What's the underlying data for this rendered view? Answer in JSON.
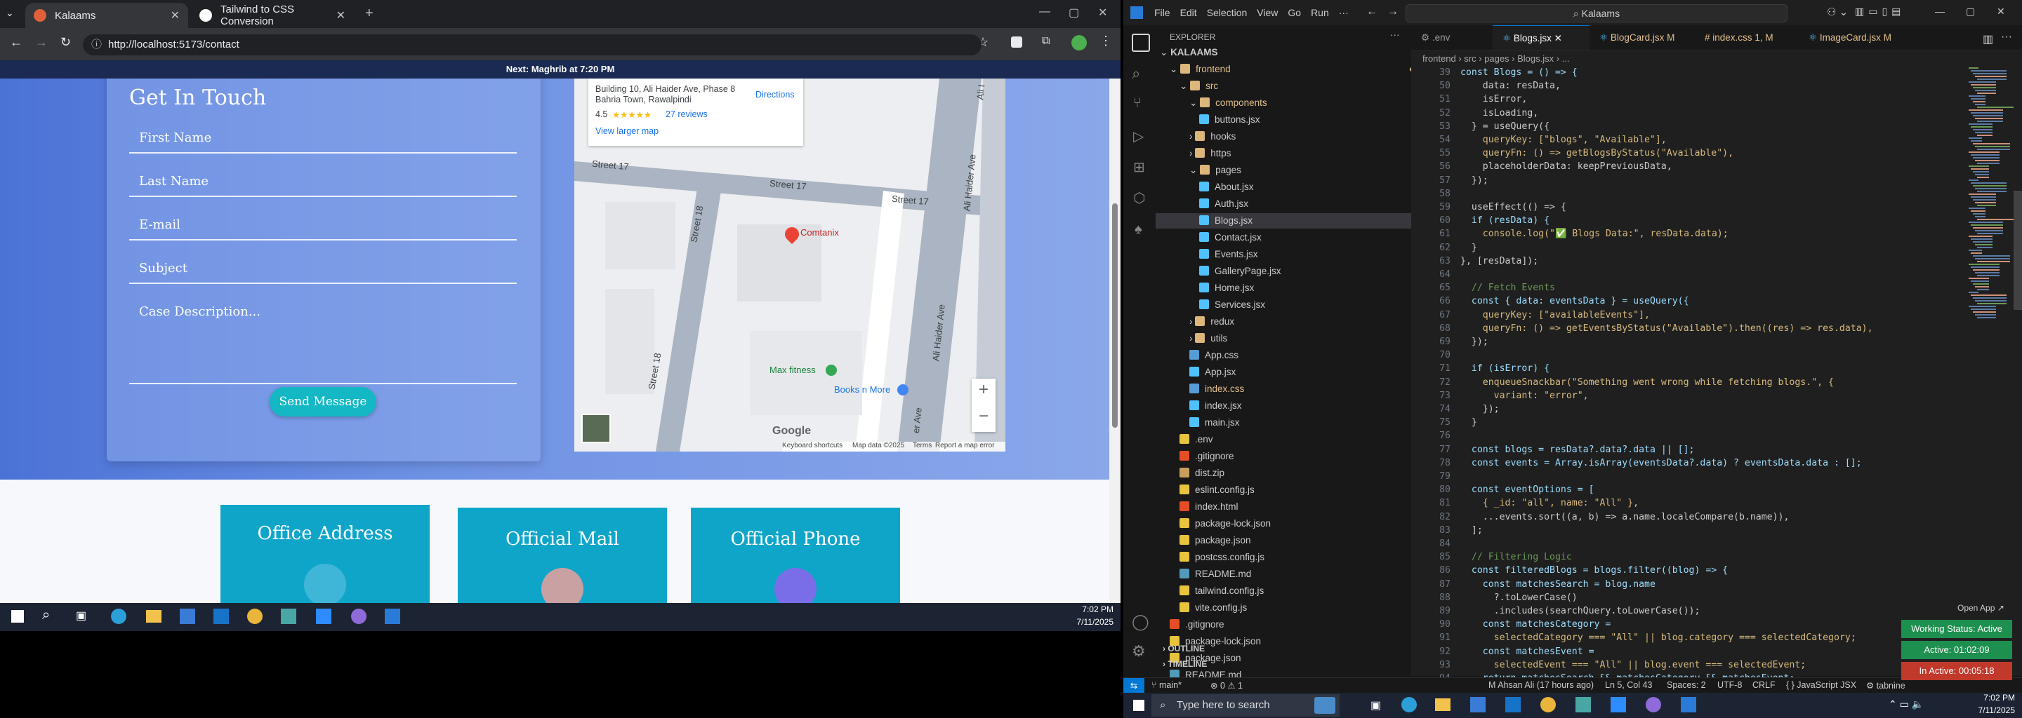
{
  "browser": {
    "tabs": [
      {
        "label": "Kalaams",
        "active": true
      },
      {
        "label": "Tailwind to CSS Conversion",
        "active": false
      }
    ],
    "url": "http://localhost:5173/contact",
    "notice": "Next: Maghrib at 7:20 PM",
    "form": {
      "title": "Get In Touch",
      "first_name": "First Name",
      "last_name": "Last Name",
      "email": "E-mail",
      "subject": "Subject",
      "description": "Case Description...",
      "send": "Send Message"
    },
    "map": {
      "address": "Building 10, Ali Haider Ave, Phase 8 Bahria Town, Rawalpindi",
      "directions": "Directions",
      "rating": "4.5",
      "stars": "★★★★★",
      "reviews": "27 reviews",
      "view_larger": "View larger map",
      "place": "Comtanix",
      "poi1": "Max fitness",
      "poi2": "Books n More",
      "street_a": "Street 17",
      "street_b": "Street 17",
      "street_c": "Street 17",
      "street_d": "Street 18",
      "street_e": "Street 18",
      "ave1": "Ali Haider Ave",
      "ave2": "Ali Haider Ave",
      "ave3": "er Ave",
      "ave4": "Ali I",
      "zoom_in": "+",
      "zoom_out": "−",
      "logo": "Google",
      "footer": [
        "Keyboard shortcuts",
        "Map data ©2025",
        "Terms",
        "Report a map error"
      ]
    },
    "cards": [
      "Office Address",
      "Official Mail",
      "Official Phone"
    ]
  },
  "left_taskbar": {
    "time": "7:02 PM",
    "date": "7/11/2025"
  },
  "vscode": {
    "menu": [
      "File",
      "Edit",
      "Selection",
      "View",
      "Go",
      "Run",
      "···"
    ],
    "search": "Kalaams",
    "explorer_title": "EXPLORER",
    "tree": [
      {
        "label": "KALAAMS",
        "indent": 0,
        "kind": "root"
      },
      {
        "label": "frontend",
        "indent": 1,
        "kind": "folder-open",
        "color": "#e2c08d"
      },
      {
        "label": "src",
        "indent": 2,
        "kind": "folder-open",
        "color": "#e2c08d"
      },
      {
        "label": "components",
        "indent": 3,
        "kind": "folder-open",
        "color": "#e2c08d"
      },
      {
        "label": "buttons.jsx",
        "indent": 4,
        "kind": "jsx"
      },
      {
        "label": "hooks",
        "indent": 3,
        "kind": "folder"
      },
      {
        "label": "https",
        "indent": 3,
        "kind": "folder"
      },
      {
        "label": "pages",
        "indent": 3,
        "kind": "folder-open"
      },
      {
        "label": "About.jsx",
        "indent": 4,
        "kind": "jsx"
      },
      {
        "label": "Auth.jsx",
        "indent": 4,
        "kind": "jsx"
      },
      {
        "label": "Blogs.jsx",
        "indent": 4,
        "kind": "jsx",
        "selected": true
      },
      {
        "label": "Contact.jsx",
        "indent": 4,
        "kind": "jsx"
      },
      {
        "label": "Events.jsx",
        "indent": 4,
        "kind": "jsx"
      },
      {
        "label": "GalleryPage.jsx",
        "indent": 4,
        "kind": "jsx"
      },
      {
        "label": "Home.jsx",
        "indent": 4,
        "kind": "jsx"
      },
      {
        "label": "Services.jsx",
        "indent": 4,
        "kind": "jsx"
      },
      {
        "label": "redux",
        "indent": 3,
        "kind": "folder"
      },
      {
        "label": "utils",
        "indent": 3,
        "kind": "folder"
      },
      {
        "label": "App.css",
        "indent": 3,
        "kind": "css"
      },
      {
        "label": "App.jsx",
        "indent": 3,
        "kind": "jsx"
      },
      {
        "label": "index.css",
        "indent": 3,
        "kind": "css",
        "badge": "1, M",
        "color": "#e2c08d"
      },
      {
        "label": "index.jsx",
        "indent": 3,
        "kind": "jsx"
      },
      {
        "label": "main.jsx",
        "indent": 3,
        "kind": "jsx"
      },
      {
        "label": ".env",
        "indent": 2,
        "kind": "env"
      },
      {
        "label": ".gitignore",
        "indent": 2,
        "kind": "git"
      },
      {
        "label": "dist.zip",
        "indent": 2,
        "kind": "zip"
      },
      {
        "label": "eslint.config.js",
        "indent": 2,
        "kind": "js"
      },
      {
        "label": "index.html",
        "indent": 2,
        "kind": "html"
      },
      {
        "label": "package-lock.json",
        "indent": 2,
        "kind": "json"
      },
      {
        "label": "package.json",
        "indent": 2,
        "kind": "json"
      },
      {
        "label": "postcss.config.js",
        "indent": 2,
        "kind": "js"
      },
      {
        "label": "README.md",
        "indent": 2,
        "kind": "md"
      },
      {
        "label": "tailwind.config.js",
        "indent": 2,
        "kind": "js"
      },
      {
        "label": "vite.config.js",
        "indent": 2,
        "kind": "js"
      },
      {
        "label": ".gitignore",
        "indent": 1,
        "kind": "git"
      },
      {
        "label": "package-lock.json",
        "indent": 1,
        "kind": "json"
      },
      {
        "label": "package.json",
        "indent": 1,
        "kind": "json"
      },
      {
        "label": "README.md",
        "indent": 1,
        "kind": "md"
      }
    ],
    "outline": "OUTLINE",
    "timeline": "TIMELINE",
    "tabs": [
      {
        "label": ".env",
        "active": false
      },
      {
        "label": "Blogs.jsx",
        "active": true
      },
      {
        "label": "BlogCard.jsx",
        "suffix": "M",
        "active": false
      },
      {
        "label": "index.css",
        "suffix": "1, M",
        "active": false
      },
      {
        "label": "ImageCard.jsx",
        "suffix": "M",
        "active": false
      }
    ],
    "breadcrumb": "frontend › src › pages › Blogs.jsx › ...",
    "code_lines": [
      {
        "n": "39",
        "t": "const Blogs = () => {"
      },
      {
        "n": "50",
        "t": "    data: resData,"
      },
      {
        "n": "51",
        "t": "    isError,"
      },
      {
        "n": "52",
        "t": "    isLoading,"
      },
      {
        "n": "53",
        "t": "  } = useQuery({"
      },
      {
        "n": "54",
        "t": "    queryKey: [\"blogs\", \"Available\"],"
      },
      {
        "n": "55",
        "t": "    queryFn: () => getBlogsByStatus(\"Available\"),"
      },
      {
        "n": "56",
        "t": "    placeholderData: keepPreviousData,"
      },
      {
        "n": "57",
        "t": "  });"
      },
      {
        "n": "58",
        "t": ""
      },
      {
        "n": "59",
        "t": "  useEffect(() => {"
      },
      {
        "n": "60",
        "t": "  if (resData) {"
      },
      {
        "n": "61",
        "t": "    console.log(\"✅ Blogs Data:\", resData.data);"
      },
      {
        "n": "62",
        "t": "  }"
      },
      {
        "n": "63",
        "t": "}, [resData]);"
      },
      {
        "n": "64",
        "t": ""
      },
      {
        "n": "65",
        "t": "  // Fetch Events"
      },
      {
        "n": "66",
        "t": "  const { data: eventsData } = useQuery({"
      },
      {
        "n": "67",
        "t": "    queryKey: [\"availableEvents\"],"
      },
      {
        "n": "68",
        "t": "    queryFn: () => getEventsByStatus(\"Available\").then((res) => res.data),"
      },
      {
        "n": "69",
        "t": "  });"
      },
      {
        "n": "70",
        "t": ""
      },
      {
        "n": "71",
        "t": "  if (isError) {"
      },
      {
        "n": "72",
        "t": "    enqueueSnackbar(\"Something went wrong while fetching blogs.\", {"
      },
      {
        "n": "73",
        "t": "      variant: \"error\","
      },
      {
        "n": "74",
        "t": "    });"
      },
      {
        "n": "75",
        "t": "  }"
      },
      {
        "n": "76",
        "t": ""
      },
      {
        "n": "77",
        "t": "  const blogs = resData?.data?.data || [];"
      },
      {
        "n": "78",
        "t": "  const events = Array.isArray(eventsData?.data) ? eventsData.data : [];"
      },
      {
        "n": "79",
        "t": ""
      },
      {
        "n": "80",
        "t": "  const eventOptions = ["
      },
      {
        "n": "81",
        "t": "    { _id: \"all\", name: \"All\" },"
      },
      {
        "n": "82",
        "t": "    ...events.sort((a, b) => a.name.localeCompare(b.name)),"
      },
      {
        "n": "83",
        "t": "  ];"
      },
      {
        "n": "84",
        "t": ""
      },
      {
        "n": "85",
        "t": "  // Filtering Logic"
      },
      {
        "n": "86",
        "t": "  const filteredBlogs = blogs.filter((blog) => {"
      },
      {
        "n": "87",
        "t": "    const matchesSearch = blog.name"
      },
      {
        "n": "88",
        "t": "      ?.toLowerCase()"
      },
      {
        "n": "89",
        "t": "      .includes(searchQuery.toLowerCase());"
      },
      {
        "n": "90",
        "t": "    const matchesCategory ="
      },
      {
        "n": "91",
        "t": "      selectedCategory === \"All\" || blog.category === selectedCategory;"
      },
      {
        "n": "92",
        "t": "    const matchesEvent ="
      },
      {
        "n": "93",
        "t": "      selectedEvent === \"All\" || blog.event === selectedEvent;"
      },
      {
        "n": "94",
        "t": "    return matchesSearch && matchesCategory && matchesEvent;"
      }
    ],
    "status": {
      "branch": "main*",
      "problems": "⊗ 0 ⚠ 1",
      "blame": "M Ahsan Ali (17 hours ago)",
      "position": "Ln 5, Col 43",
      "spaces": "Spaces: 2",
      "encoding": "UTF-8",
      "eol": "CRLF",
      "lang": "{ } JavaScript JSX",
      "extra": "⚙ tabnine"
    },
    "widgets": {
      "open_app": "Open App ↗",
      "working": "Working Status: Active",
      "active": "Active: 01:02:09",
      "inactive": "In Active: 00:05:18"
    }
  },
  "right_taskbar": {
    "search": "Type here to search",
    "time": "7:02 PM",
    "date": "7/11/2025"
  }
}
